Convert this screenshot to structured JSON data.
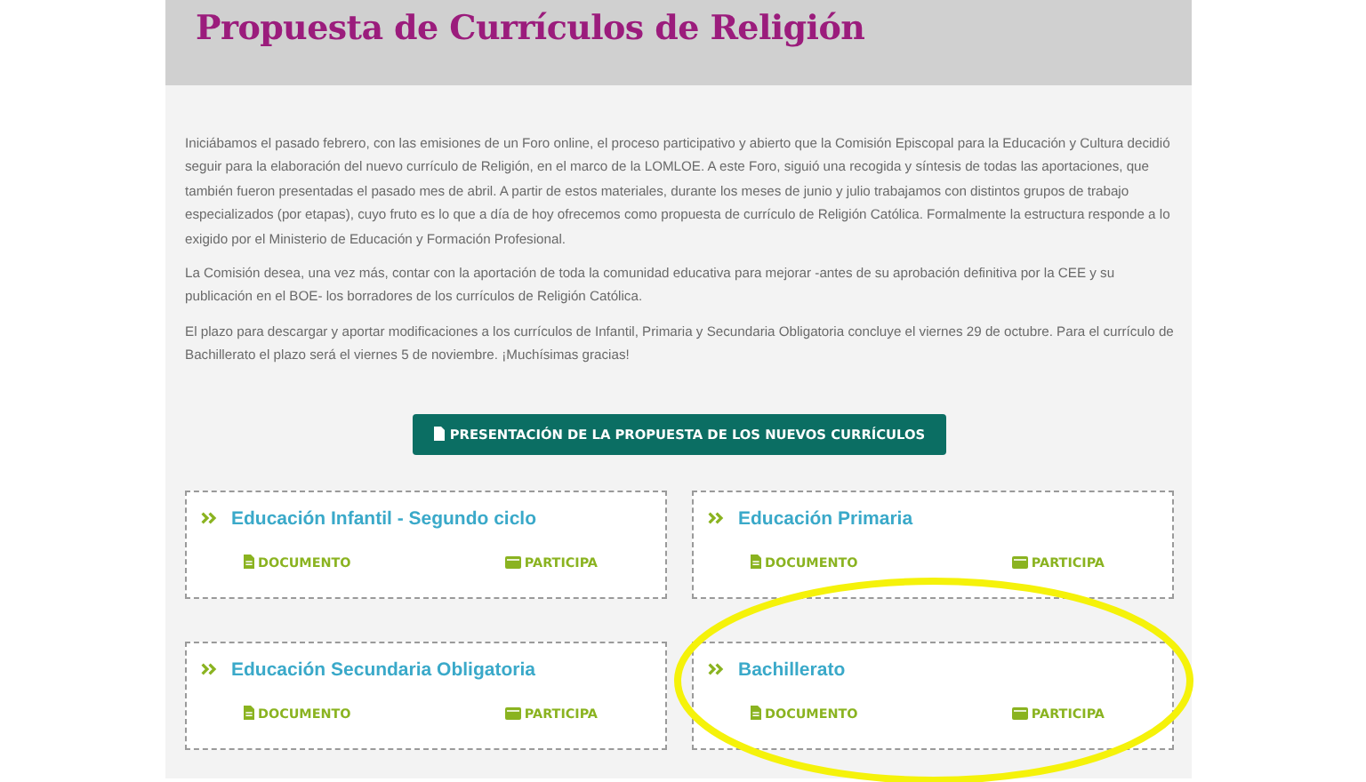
{
  "header": {
    "title": "Propuesta de Currículos de Religión"
  },
  "paragraphs": [
    "Iniciábamos el pasado febrero, con las emisiones de un Foro online, el proceso participativo y abierto que la Comisión Episcopal para la Educación y Cultura decidió seguir para la elaboración del nuevo currículo de Religión, en el marco de la LOMLOE. A este Foro, siguió una recogida y síntesis de todas las aportaciones, que también fueron presentadas el pasado mes de abril. A partir de estos materiales, durante los meses de junio y julio trabajamos con distintos grupos de trabajo especializados (por etapas), cuyo fruto es lo que a día de hoy ofrecemos como propuesta de currículo de Religión Católica. Formalmente la estructura responde a lo exigido por el Ministerio de Educación y Formación Profesional.",
    "La Comisión desea, una vez más, contar con la aportación de toda la comunidad educativa para mejorar -antes de su aprobación definitiva por la CEE y su publicación en el BOE- los borradores de los currículos de Religión Católica.",
    "El plazo para descargar y aportar modificaciones a los currículos de Infantil, Primaria y Secundaria Obligatoria concluye el viernes 29 de octubre. Para el currículo de Bachillerato el plazo será el viernes 5 de noviembre. ¡Muchísimas gracias!"
  ],
  "main_button": {
    "label": "PRESENTACIÓN DE LA PROPUESTA DE LOS NUEVOS CURRÍCULOS"
  },
  "cards": [
    {
      "title": "Educación Infantil - Segundo ciclo",
      "links": [
        {
          "kind": "document",
          "label": "DOCUMENTO"
        },
        {
          "kind": "participate",
          "label": "PARTICIPA"
        }
      ]
    },
    {
      "title": "Educación Primaria",
      "links": [
        {
          "kind": "document",
          "label": "DOCUMENTO"
        },
        {
          "kind": "participate",
          "label": "PARTICIPA"
        }
      ]
    },
    {
      "title": "Educación Secundaria Obligatoria",
      "links": [
        {
          "kind": "document",
          "label": "DOCUMENTO"
        },
        {
          "kind": "participate",
          "label": "PARTICIPA"
        }
      ]
    },
    {
      "title": "Bachillerato",
      "links": [
        {
          "kind": "document",
          "label": "DOCUMENTO"
        },
        {
          "kind": "participate",
          "label": "PARTICIPA"
        }
      ]
    }
  ],
  "annotation": {
    "kind": "ellipse",
    "color": "#f5f20a"
  }
}
